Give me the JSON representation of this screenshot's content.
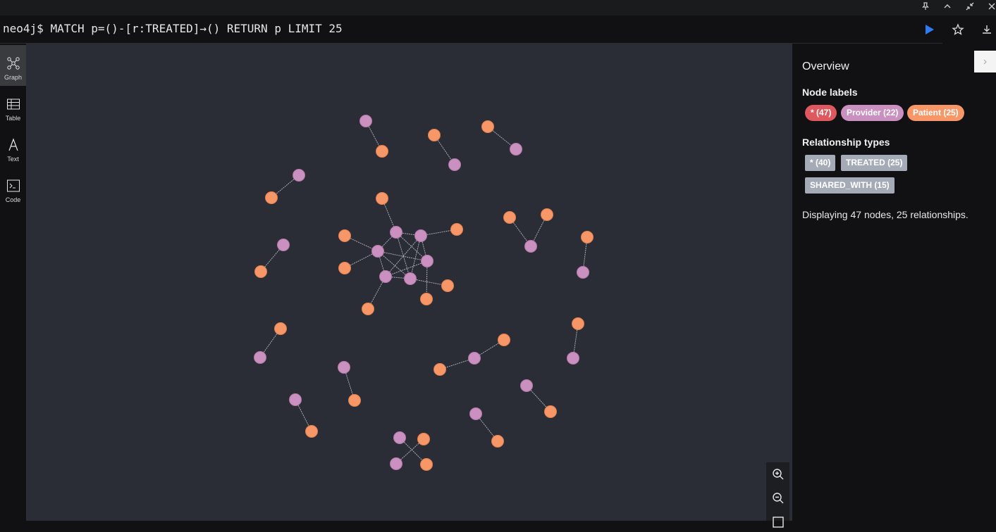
{
  "query": {
    "prompt": "neo4j$",
    "text": "MATCH p=()-[r:TREATED]→() RETURN p LIMIT 25"
  },
  "window_controls": [
    "pin-icon",
    "chevron-up-icon",
    "shrink-icon",
    "close-icon"
  ],
  "sidebar": {
    "items": [
      {
        "label": "Graph",
        "icon": "graph-icon",
        "active": true
      },
      {
        "label": "Table",
        "icon": "table-icon",
        "active": false
      },
      {
        "label": "Text",
        "icon": "text-icon",
        "active": false
      },
      {
        "label": "Code",
        "icon": "code-icon",
        "active": false
      }
    ]
  },
  "overview": {
    "title": "Overview",
    "node_labels_title": "Node labels",
    "node_labels": [
      {
        "label": "* (47)",
        "color": "#e0585f"
      },
      {
        "label": "Provider (22)",
        "color": "#c990c0"
      },
      {
        "label": "Patient (25)",
        "color": "#f79767"
      }
    ],
    "relationship_types_title": "Relationship types",
    "relationship_types": [
      {
        "label": "* (40)"
      },
      {
        "label": "TREATED (25)"
      },
      {
        "label": "SHARED_WITH (15)"
      }
    ],
    "status": "Displaying 47 nodes, 25 relationships."
  },
  "colors": {
    "provider": "#c990c0",
    "patient": "#f79767",
    "canvas": "#2b2d36",
    "edge": "#a5abb6",
    "run": "#2f7bf5"
  }
}
